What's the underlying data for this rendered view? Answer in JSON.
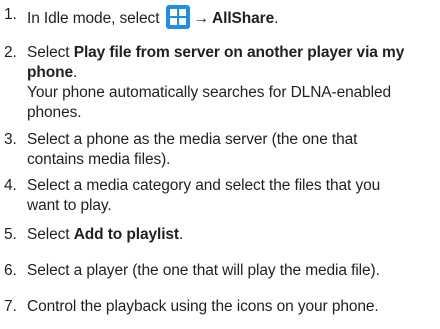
{
  "steps": [
    {
      "number": "1.",
      "prefix": "In Idle mode, select",
      "icon": "apps-grid-icon",
      "arrow": "→",
      "bold": "AllShare",
      "suffix": "."
    },
    {
      "number": "2.",
      "prefix": "Select",
      "bold_line1": "Play file from server on another player via my",
      "bold_line2": "phone",
      "suffix": ".",
      "note_line1": "Your phone automatically searches for DLNA-enabled",
      "note_line2": "phones."
    },
    {
      "number": "3.",
      "line1": "Select a phone as the media server (the one that",
      "line2": "contains media files)."
    },
    {
      "number": "4.",
      "line1": "Select a media category and select the files that you",
      "line2": "want to play."
    },
    {
      "number": "5.",
      "prefix": "Select",
      "bold": "Add to playlist",
      "suffix": "."
    },
    {
      "number": "6.",
      "text": "Select a player (the one that will play the media file)."
    },
    {
      "number": "7.",
      "text": "Control the playback using the icons on your phone."
    }
  ],
  "colors": {
    "text": "#231f20",
    "icon_background": "#1f8ee6",
    "icon_foreground": "#ffffff"
  }
}
